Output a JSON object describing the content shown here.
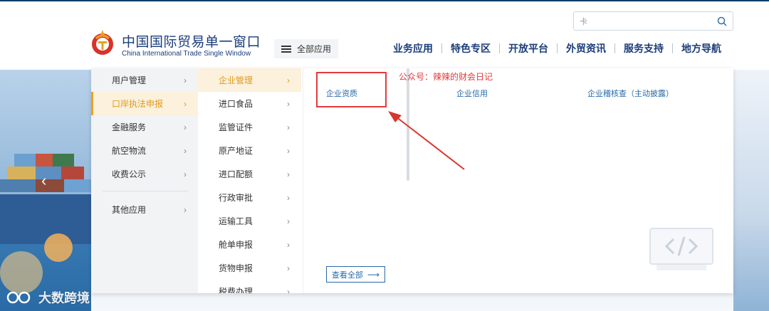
{
  "header": {
    "title": "中国国际贸易单一窗口",
    "subtitle": "China International Trade Single Window",
    "all_apps_label": "全部应用",
    "search_value": "卡",
    "nav": [
      "业务应用",
      "特色专区",
      "开放平台",
      "外贸资讯",
      "服务支持",
      "地方导航"
    ]
  },
  "menu": {
    "level1": [
      {
        "label": "用户管理"
      },
      {
        "label": "口岸执法申报",
        "active": true
      },
      {
        "label": "金融服务"
      },
      {
        "label": "航空物流"
      },
      {
        "label": "收费公示"
      },
      {
        "label": "其他应用"
      }
    ],
    "level2": [
      {
        "label": "企业管理",
        "active": true
      },
      {
        "label": "进口食品"
      },
      {
        "label": "监管证件"
      },
      {
        "label": "原产地证"
      },
      {
        "label": "进口配额"
      },
      {
        "label": "行政审批"
      },
      {
        "label": "运输工具"
      },
      {
        "label": "舱单申报"
      },
      {
        "label": "货物申报"
      },
      {
        "label": "税费办理"
      }
    ],
    "level3": [
      "企业资质",
      "企业信用",
      "企业稽核查（主动披露）"
    ],
    "view_all_label": "查看全部"
  },
  "annotation": {
    "text": "公众号：辣辣的财会日记",
    "color": "#e23b3b"
  },
  "watermark": {
    "text": "大数跨境"
  },
  "colors": {
    "brand_blue": "#1c3d7a",
    "link_blue": "#2a6aa8",
    "active_orange": "#e09a1f",
    "active_bg": "#fbf1dc"
  }
}
